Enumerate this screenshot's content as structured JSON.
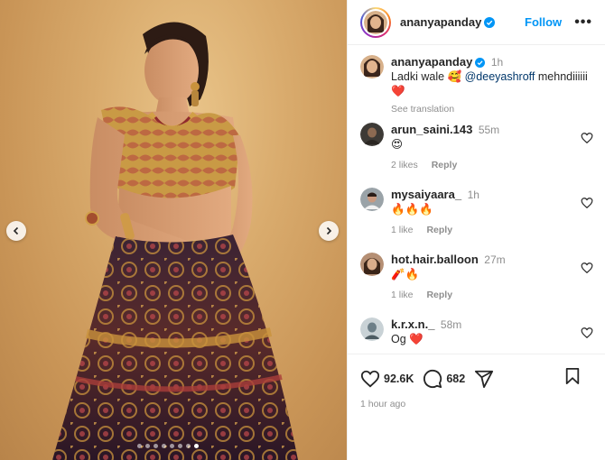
{
  "header": {
    "username": "ananyapanday",
    "follow_label": "Follow",
    "more_label": "•••"
  },
  "caption": {
    "username": "ananyapanday",
    "time": "1h",
    "text_before": "Ladki wale ",
    "emoji_1": "🥰",
    "mention": "@deeyashroff",
    "text_after": " mehndiiiiii",
    "emoji_2": "❤️",
    "see_translation": "See translation"
  },
  "comments": [
    {
      "username": "arun_saini.143",
      "time": "55m",
      "text": "😍",
      "likes": "2 likes",
      "reply": "Reply"
    },
    {
      "username": "mysaiyaara_",
      "time": "1h",
      "text": "🔥🔥🔥",
      "likes": "1 like",
      "reply": "Reply"
    },
    {
      "username": "hot.hair.balloon",
      "time": "27m",
      "text": "🧨🔥",
      "likes": "1 like",
      "reply": "Reply"
    },
    {
      "username": "k.r.x.n._",
      "time": "58m",
      "text": "Og ❤️",
      "likes": "",
      "reply": ""
    }
  ],
  "actions": {
    "likes": "92.6K",
    "comments": "682",
    "post_time": "1 hour ago"
  },
  "carousel": {
    "total_slides": 8,
    "active_slide": 8
  },
  "colors": {
    "accent": "#0095f6",
    "verified": "#0095f6",
    "text": "#262626",
    "muted": "#8e8e8e"
  },
  "icons": [
    "chevron-left-icon",
    "chevron-right-icon",
    "verified-badge-icon",
    "heart-icon",
    "comment-icon",
    "share-icon",
    "bookmark-icon",
    "more-icon"
  ]
}
